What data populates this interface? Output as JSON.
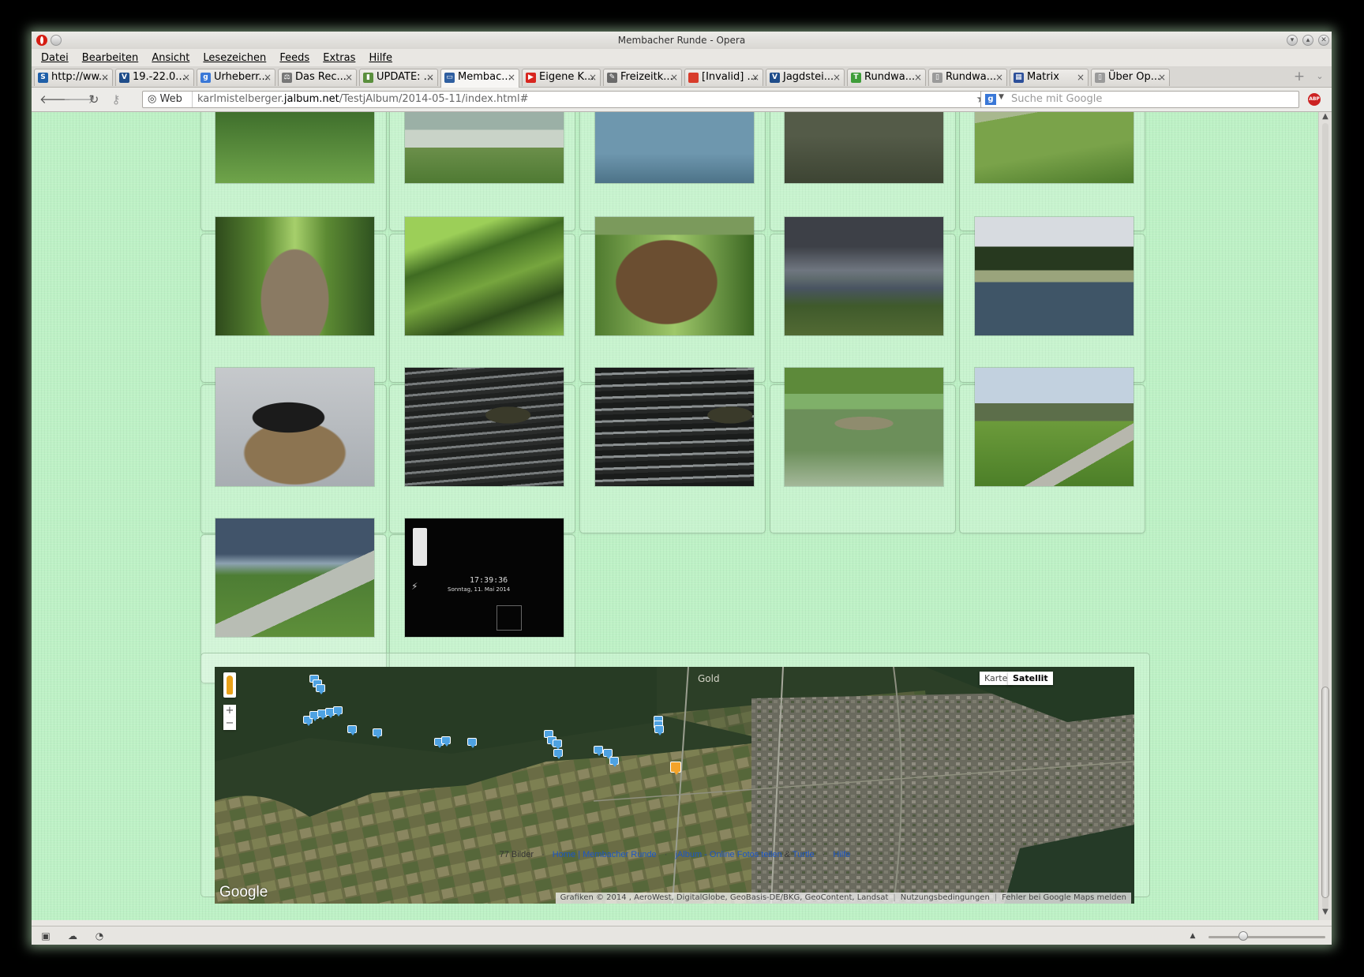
{
  "window": {
    "title": "Membacher Runde - Opera"
  },
  "menu": [
    "Datei",
    "Bearbeiten",
    "Ansicht",
    "Lesezeichen",
    "Feeds",
    "Extras",
    "Hilfe"
  ],
  "tabs": [
    {
      "label": "http://ww...",
      "icon": "s-icon",
      "color": "#1f5fa8",
      "glyph": "S"
    },
    {
      "label": "19.-22.0...",
      "icon": "site-icon",
      "color": "#1f4d8a",
      "glyph": "V"
    },
    {
      "label": "Urheberr...",
      "icon": "google-icon",
      "color": "#3a78d7",
      "glyph": "g"
    },
    {
      "label": "Das Rec...",
      "icon": "scale-icon",
      "color": "#777777",
      "glyph": "⚖"
    },
    {
      "label": "UPDATE: ...",
      "icon": "chart-icon",
      "color": "#5a8f3d",
      "glyph": "▮"
    },
    {
      "label": "Membac...",
      "icon": "monitor-icon",
      "color": "#2f5fa0",
      "glyph": "▭",
      "active": true
    },
    {
      "label": "Eigene K...",
      "icon": "youtube-icon",
      "color": "#d8261f",
      "glyph": "▶"
    },
    {
      "label": "Freizeitk...",
      "icon": "pin-icon",
      "color": "#6a6a6a",
      "glyph": "✎"
    },
    {
      "label": "[Invalid] ...",
      "icon": "red-square-icon",
      "color": "#d83c2b",
      "glyph": ""
    },
    {
      "label": "Jagdstei...",
      "icon": "site-icon",
      "color": "#1f4d8a",
      "glyph": "V"
    },
    {
      "label": "Rundwa...",
      "icon": "tree-icon",
      "color": "#3f9d3a",
      "glyph": "T"
    },
    {
      "label": "Rundwa...",
      "icon": "page-icon",
      "color": "#9a9a9a",
      "glyph": "▯"
    },
    {
      "label": "Matrix",
      "icon": "grid-icon",
      "color": "#2c4f9a",
      "glyph": "▦"
    },
    {
      "label": "Über Op...",
      "icon": "page-icon",
      "color": "#9a9a9a",
      "glyph": "▯"
    }
  ],
  "address": {
    "prefix_label": "Web",
    "url_pre": "karlmistelberger.",
    "url_host": "jalbum.net",
    "url_post": "/TestjAlbum/2014-05-11/index.html#",
    "search_placeholder": "Suche mit Google",
    "search_engine_glyph": "g",
    "adblock_label": "ABP"
  },
  "map": {
    "btn_map": "Karte",
    "btn_satellite": "Satellit",
    "zoom_in": "+",
    "zoom_out": "−",
    "google_logo": "Google",
    "attribution": "Grafiken © 2014 , AeroWest, DigitalGlobe, GeoBasis-DE/BKG, GeoContent, Landsat",
    "terms": "Nutzungsbedingungen",
    "report": "Fehler bei Google Maps melden",
    "place_label": "Gold"
  },
  "footer": {
    "count": "77 Bilder",
    "home": "Home",
    "album": "Membacher Runde",
    "jalbum": "jAlbum - Online Fotos teilen",
    "amp": "&",
    "turtle": "Turtle",
    "help": "Hilfe",
    "dot": "·",
    "pipe": "|"
  },
  "photo_overlay": {
    "time": "17:39:36",
    "date": "Sonntag, 11. Mai 2014"
  },
  "statusbar": {
    "panel_icon": "panel-toggle-icon",
    "cloud_icon": "unite-icon",
    "speed_icon": "turbo-icon"
  },
  "colors": {
    "page_bg": "#bdf1c5",
    "link": "#1c56c4",
    "marker_blue": "#4ea2e2",
    "marker_orange": "#f3a32a"
  }
}
